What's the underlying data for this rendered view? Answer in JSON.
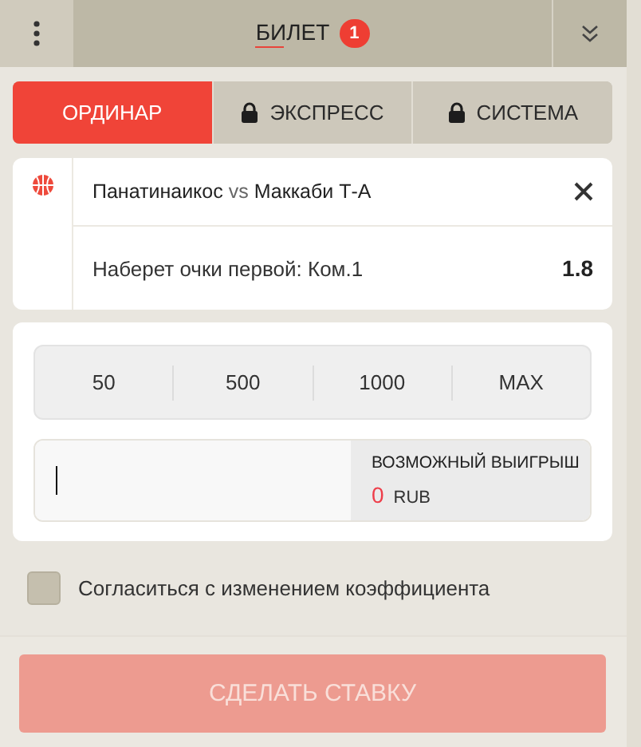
{
  "header": {
    "title": "БИЛЕТ",
    "badge": "1"
  },
  "tabs": [
    {
      "label": "ОРДИНАР",
      "selected": true,
      "locked": false
    },
    {
      "label": "ЭКСПРЕСС",
      "selected": false,
      "locked": true
    },
    {
      "label": "СИСТЕМА",
      "selected": false,
      "locked": true
    }
  ],
  "bet": {
    "team_1": "Панатинаикос",
    "vs": "vs",
    "team_2": "Маккаби Т-А",
    "market": "Наберет очки первой: Ком.1",
    "odds": "1.8"
  },
  "quick_amounts": [
    "50",
    "500",
    "1000",
    "MAX"
  ],
  "stake": {
    "win_label": "ВОЗМОЖНЫЙ ВЫИГРЫШ",
    "win_amount": "0",
    "currency": "RUB"
  },
  "accept_odds": {
    "label": "Согласиться с изменением коэффициента",
    "checked": false
  },
  "submit": {
    "label": "СДЕЛАТЬ СТАВКУ",
    "disabled": true
  }
}
